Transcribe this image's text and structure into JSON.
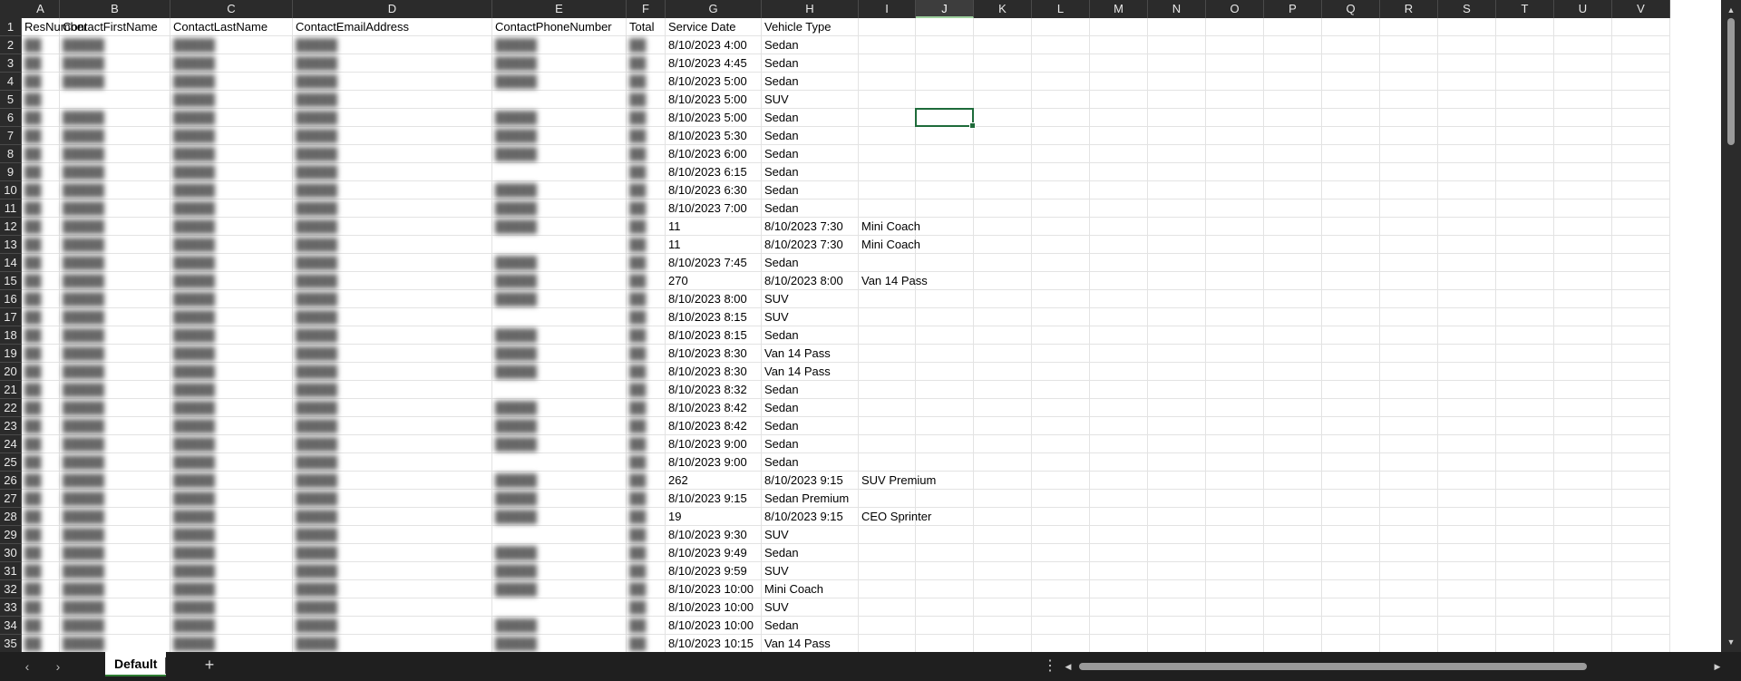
{
  "columns": [
    {
      "letter": "A",
      "w": 42
    },
    {
      "letter": "B",
      "w": 122
    },
    {
      "letter": "C",
      "w": 135
    },
    {
      "letter": "D",
      "w": 220
    },
    {
      "letter": "E",
      "w": 148
    },
    {
      "letter": "F",
      "w": 43
    },
    {
      "letter": "G",
      "w": 106
    },
    {
      "letter": "H",
      "w": 107
    },
    {
      "letter": "I",
      "w": 63
    },
    {
      "letter": "J",
      "w": 64
    },
    {
      "letter": "K",
      "w": 64
    },
    {
      "letter": "L",
      "w": 64
    },
    {
      "letter": "M",
      "w": 64
    },
    {
      "letter": "N",
      "w": 64
    },
    {
      "letter": "O",
      "w": 64
    },
    {
      "letter": "P",
      "w": 64
    },
    {
      "letter": "Q",
      "w": 64
    },
    {
      "letter": "R",
      "w": 64
    },
    {
      "letter": "S",
      "w": 64
    },
    {
      "letter": "T",
      "w": 64
    },
    {
      "letter": "U",
      "w": 64
    },
    {
      "letter": "V",
      "w": 64
    }
  ],
  "selected_col": "J",
  "selected_cell": {
    "col": 9,
    "row": 6
  },
  "headers": [
    "ResNumber",
    "ContactFirstName",
    "ContactLastName",
    "ContactEmailAddress",
    "ContactPhoneNumber",
    "Total",
    "Service Date",
    "Vehicle Type"
  ],
  "rows": [
    {
      "g": "8/10/2023 4:00",
      "h": "Sedan"
    },
    {
      "g": "8/10/2023 4:45",
      "h": "Sedan"
    },
    {
      "g": "8/10/2023 5:00",
      "h": "Sedan"
    },
    {
      "g": "8/10/2023 5:00",
      "h": "SUV"
    },
    {
      "g": "8/10/2023 5:00",
      "h": "Sedan"
    },
    {
      "g": "8/10/2023 5:30",
      "h": "Sedan"
    },
    {
      "g": "8/10/2023 6:00",
      "h": "Sedan"
    },
    {
      "g": "8/10/2023 6:15",
      "h": "Sedan"
    },
    {
      "g": "8/10/2023 6:30",
      "h": "Sedan"
    },
    {
      "g": "8/10/2023 7:00",
      "h": "Sedan"
    },
    {
      "g": "11",
      "h": "8/10/2023 7:30",
      "i": "Mini Coach"
    },
    {
      "g": "11",
      "h": "8/10/2023 7:30",
      "i": "Mini Coach"
    },
    {
      "g": "8/10/2023 7:45",
      "h": "Sedan"
    },
    {
      "g": "270",
      "h": "8/10/2023 8:00",
      "i": "Van 14 Pass"
    },
    {
      "g": "8/10/2023 8:00",
      "h": "SUV"
    },
    {
      "g": "8/10/2023 8:15",
      "h": "SUV"
    },
    {
      "g": "8/10/2023 8:15",
      "h": "Sedan"
    },
    {
      "g": "8/10/2023 8:30",
      "h": "Van 14 Pass"
    },
    {
      "g": "8/10/2023 8:30",
      "h": "Van 14 Pass"
    },
    {
      "g": "8/10/2023 8:32",
      "h": "Sedan"
    },
    {
      "g": "8/10/2023 8:42",
      "h": "Sedan"
    },
    {
      "g": "8/10/2023 8:42",
      "h": "Sedan"
    },
    {
      "g": "8/10/2023 9:00",
      "h": "Sedan"
    },
    {
      "g": "8/10/2023 9:00",
      "h": "Sedan"
    },
    {
      "g": "262",
      "h": "8/10/2023 9:15",
      "i": "SUV Premium"
    },
    {
      "g": "8/10/2023 9:15",
      "h": "Sedan Premium"
    },
    {
      "g": "19",
      "h": "8/10/2023 9:15",
      "i": "CEO Sprinter"
    },
    {
      "g": "8/10/2023 9:30",
      "h": "SUV"
    },
    {
      "g": "8/10/2023 9:49",
      "h": "Sedan"
    },
    {
      "g": "8/10/2023 9:59",
      "h": "SUV"
    },
    {
      "g": "8/10/2023 10:00",
      "h": "Mini Coach"
    },
    {
      "g": "8/10/2023 10:00",
      "h": "SUV"
    },
    {
      "g": "8/10/2023 10:00",
      "h": "Sedan"
    },
    {
      "g": "8/10/2023 10:15",
      "h": "Van 14 Pass"
    }
  ],
  "sheet_tab": "Default",
  "icons": {
    "prev": "chevron-left-icon",
    "next": "chevron-right-icon",
    "add": "plus-icon",
    "more": "more-vertical-icon"
  }
}
